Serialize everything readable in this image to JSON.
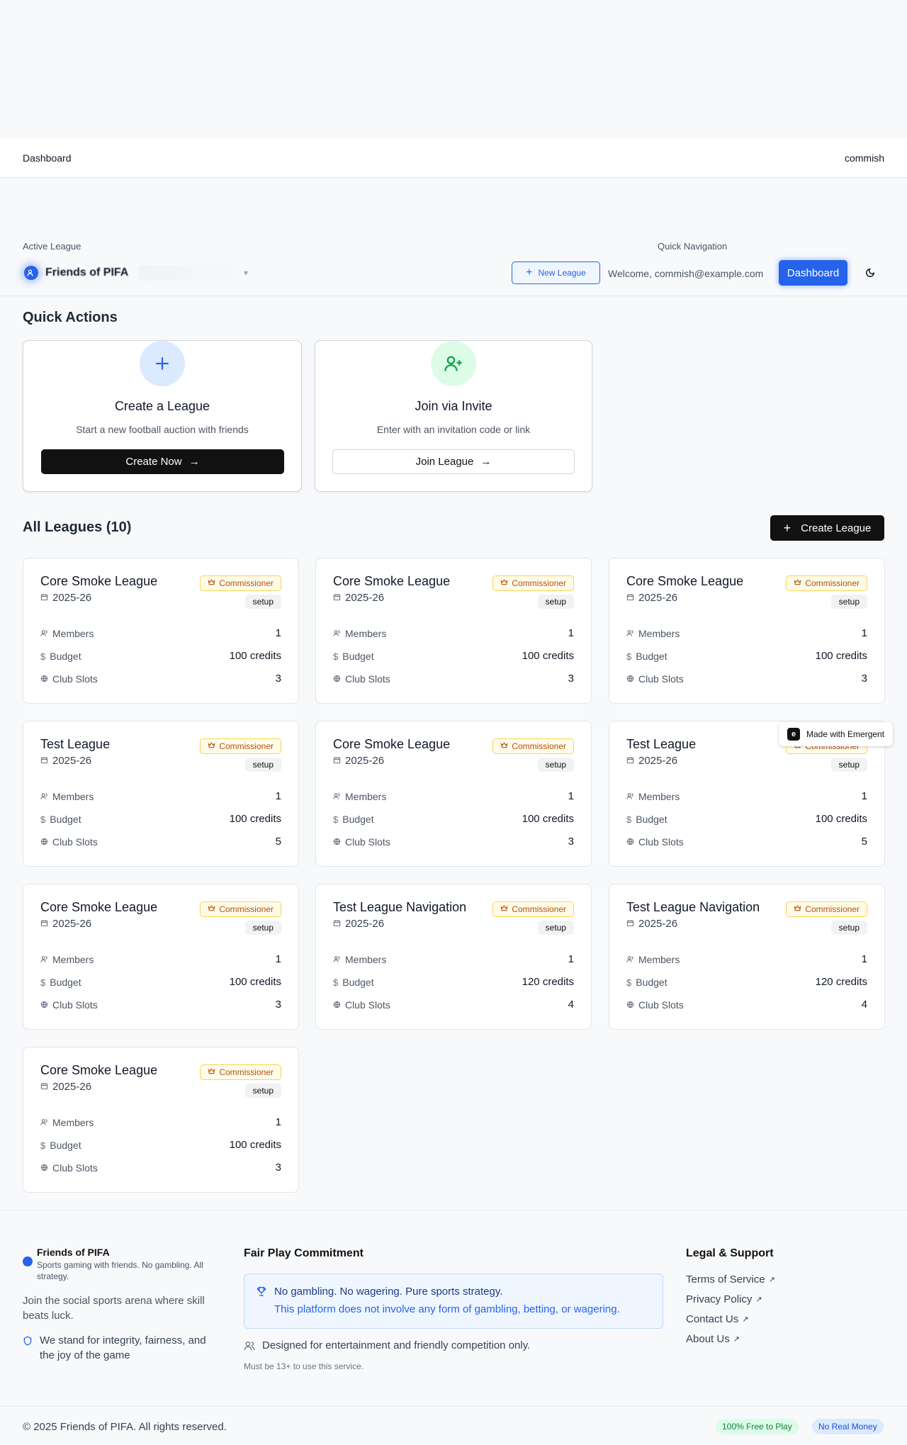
{
  "breadcrumb": {
    "current": "Dashboard",
    "user": "commish"
  },
  "league_bar": {
    "active_label": "Active League",
    "active_name": "Friends of PIFA",
    "quick_nav_label": "Quick Navigation",
    "new_league": "New League",
    "welcome": "Welcome, commish@example.com",
    "dashboard": "Dashboard"
  },
  "quick_actions": {
    "title": "Quick Actions",
    "cards": [
      {
        "title": "Create a League",
        "desc": "Start a new football auction with friends",
        "button": "Create Now"
      },
      {
        "title": "Join via Invite",
        "desc": "Enter with an invitation code or link",
        "button": "Join League"
      }
    ]
  },
  "all_leagues": {
    "title": "All Leagues (10)",
    "create_button": "Create League",
    "labels": {
      "members": "Members",
      "budget": "Budget",
      "club_slots": "Club Slots"
    },
    "items": [
      {
        "name": "Core Smoke League",
        "season": "2025-26",
        "role": "Commissioner",
        "status": "setup",
        "members": "1",
        "budget": "100 credits",
        "club_slots": "3"
      },
      {
        "name": "Core Smoke League",
        "season": "2025-26",
        "role": "Commissioner",
        "status": "setup",
        "members": "1",
        "budget": "100 credits",
        "club_slots": "3"
      },
      {
        "name": "Core Smoke League",
        "season": "2025-26",
        "role": "Commissioner",
        "status": "setup",
        "members": "1",
        "budget": "100 credits",
        "club_slots": "3"
      },
      {
        "name": "Test League",
        "season": "2025-26",
        "role": "Commissioner",
        "status": "setup",
        "members": "1",
        "budget": "100 credits",
        "club_slots": "5"
      },
      {
        "name": "Core Smoke League",
        "season": "2025-26",
        "role": "Commissioner",
        "status": "setup",
        "members": "1",
        "budget": "100 credits",
        "club_slots": "3"
      },
      {
        "name": "Test League",
        "season": "2025-26",
        "role": "Commissioner",
        "status": "setup",
        "members": "1",
        "budget": "100 credits",
        "club_slots": "5"
      },
      {
        "name": "Core Smoke League",
        "season": "2025-26",
        "role": "Commissioner",
        "status": "setup",
        "members": "1",
        "budget": "100 credits",
        "club_slots": "3"
      },
      {
        "name": "Test League Navigation",
        "season": "2025-26",
        "role": "Commissioner",
        "status": "setup",
        "members": "1",
        "budget": "120 credits",
        "club_slots": "4"
      },
      {
        "name": "Test League Navigation",
        "season": "2025-26",
        "role": "Commissioner",
        "status": "setup",
        "members": "1",
        "budget": "120 credits",
        "club_slots": "4"
      },
      {
        "name": "Core Smoke League",
        "season": "2025-26",
        "role": "Commissioner",
        "status": "setup",
        "members": "1",
        "budget": "100 credits",
        "club_slots": "3"
      }
    ]
  },
  "emergent_badge": "Made with Emergent",
  "footer": {
    "brand_name": "Friends of PIFA",
    "brand_tagline": "Sports gaming with friends. No gambling. All strategy.",
    "join_text": "Join the social sports arena where skill beats luck.",
    "integrity": "We stand for integrity, fairness, and the joy of the game",
    "fair_title": "Fair Play Commitment",
    "fair_line1": "No gambling. No wagering. Pure sports strategy.",
    "fair_line2": "This platform does not involve any form of gambling, betting, or wagering.",
    "designed": "Designed for entertainment and friendly competition only.",
    "age": "Must be 13+ to use this service.",
    "legal_title": "Legal & Support",
    "legal_links": [
      "Terms of Service",
      "Privacy Policy",
      "Contact Us",
      "About Us"
    ],
    "copyright": "© 2025 Friends of PIFA. All rights reserved.",
    "pill_free": "100% Free to Play",
    "pill_money": "No Real Money"
  }
}
